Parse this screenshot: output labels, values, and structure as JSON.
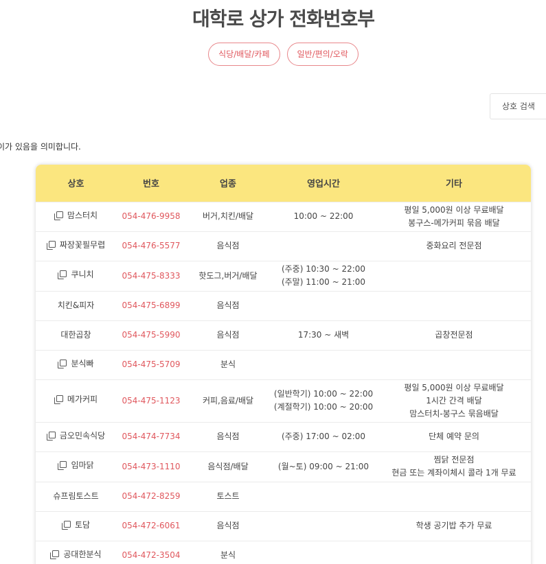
{
  "page": {
    "title": "대학로 상가 전화번호부",
    "categories": [
      "식당/배달/카페",
      "일반/편의/오락"
    ],
    "search_label": "상호 검색",
    "notice": "이가 있음을 의미합니다."
  },
  "table": {
    "headers": [
      "상호",
      "번호",
      "업종",
      "영업시간",
      "기타"
    ],
    "rows": [
      {
        "name": "맘스터치",
        "copy": true,
        "phone": "054-476-9958",
        "category": "버거,치킨/배달",
        "hours": [
          "10:00 ~ 22:00"
        ],
        "etc": [
          "평일 5,000원 이상 무료배달",
          "봉구스-메가커피 묶음 배달"
        ]
      },
      {
        "name": "짜장꽃필무렵",
        "copy": true,
        "phone": "054-476-5577",
        "category": "음식점",
        "hours": [],
        "etc": [
          "중화요리 전문점"
        ]
      },
      {
        "name": "쿠니치",
        "copy": true,
        "phone": "054-475-8333",
        "category": "핫도그,버거/배달",
        "hours": [
          "(주중) 10:30 ~ 22:00",
          "(주말) 11:00 ~ 21:00"
        ],
        "etc": []
      },
      {
        "name": "치킨&피자",
        "copy": false,
        "phone": "054-475-6899",
        "category": "음식점",
        "hours": [],
        "etc": []
      },
      {
        "name": "대한곱창",
        "copy": false,
        "phone": "054-475-5990",
        "category": "음식점",
        "hours": [
          "17:30 ~ 새벽"
        ],
        "etc": [
          "곱창전문점"
        ]
      },
      {
        "name": "분식빠",
        "copy": true,
        "phone": "054-475-5709",
        "category": "분식",
        "hours": [],
        "etc": []
      },
      {
        "name": "메가커피",
        "copy": true,
        "phone": "054-475-1123",
        "category": "커피,음료/배달",
        "hours": [
          "(일반학기) 10:00 ~ 22:00",
          "(계절학기) 10:00 ~ 20:00"
        ],
        "etc": [
          "평일 5,000원 이상 무료배달",
          "1시간 간격 배달",
          "맘스터치-봉구스 묶음배달"
        ]
      },
      {
        "name": "금오민속식당",
        "copy": true,
        "phone": "054-474-7734",
        "category": "음식점",
        "hours": [
          "(주중) 17:00 ~ 02:00"
        ],
        "etc": [
          "단체 예약 문의"
        ]
      },
      {
        "name": "임마닭",
        "copy": true,
        "phone": "054-473-1110",
        "category": "음식점/배달",
        "hours": [
          "(월~토) 09:00 ~ 21:00"
        ],
        "etc": [
          "찜닭 전문점",
          "현금 또는 계좌이체시 콜라 1개 무료"
        ]
      },
      {
        "name": "슈프림토스트",
        "copy": false,
        "phone": "054-472-8259",
        "category": "토스트",
        "hours": [],
        "etc": []
      },
      {
        "name": "토담",
        "copy": true,
        "phone": "054-472-6061",
        "category": "음식점",
        "hours": [],
        "etc": [
          "학생 공기밥 추가 무료"
        ]
      },
      {
        "name": "공대한분식",
        "copy": true,
        "phone": "054-472-3504",
        "category": "분식",
        "hours": [],
        "etc": []
      }
    ]
  },
  "colors": {
    "accent": "#e0575d",
    "header_bg": "#fbe67f"
  }
}
